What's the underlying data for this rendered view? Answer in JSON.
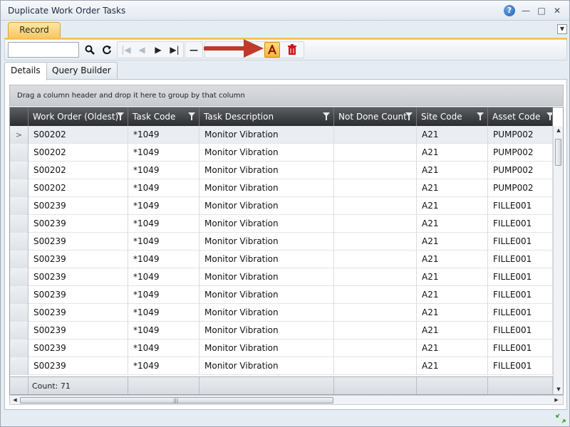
{
  "window": {
    "title": "Duplicate Work Order Tasks",
    "help_glyph": "?",
    "minimize_glyph": "—",
    "maximize_glyph": "□",
    "close_glyph": "✕"
  },
  "ribbon": {
    "tab_label": "Record",
    "dropdown_glyph": "▼"
  },
  "toolbar": {
    "search_value": "",
    "search_glyph": "🔍",
    "refresh_glyph": "↻",
    "first_glyph": "|◀",
    "prev_glyph": "◀",
    "next_glyph": "▶",
    "last_glyph": "▶|",
    "remove_glyph": "—",
    "highlight_glyph": "A",
    "delete_glyph": "🗑"
  },
  "tabs": [
    {
      "label": "Details",
      "active": true
    },
    {
      "label": "Query Builder",
      "active": false
    }
  ],
  "group_bar_text": "Drag a column header and drop it here to group by that column",
  "columns": [
    "Work Order (Oldest)",
    "Task Code",
    "Task Description",
    "Not Done Count",
    "Site Code",
    "Asset Code"
  ],
  "rows": [
    {
      "work_order": "S00202",
      "task_code": "*1049",
      "description": "Monitor Vibration",
      "not_done": "",
      "site": "A21",
      "asset": "PUMP002",
      "indicator": ">"
    },
    {
      "work_order": "S00202",
      "task_code": "*1049",
      "description": "Monitor Vibration",
      "not_done": "",
      "site": "A21",
      "asset": "PUMP002",
      "indicator": ""
    },
    {
      "work_order": "S00202",
      "task_code": "*1049",
      "description": "Monitor Vibration",
      "not_done": "",
      "site": "A21",
      "asset": "PUMP002",
      "indicator": ""
    },
    {
      "work_order": "S00202",
      "task_code": "*1049",
      "description": "Monitor Vibration",
      "not_done": "",
      "site": "A21",
      "asset": "PUMP002",
      "indicator": ""
    },
    {
      "work_order": "S00239",
      "task_code": "*1049",
      "description": "Monitor Vibration",
      "not_done": "",
      "site": "A21",
      "asset": "FILLE001",
      "indicator": ""
    },
    {
      "work_order": "S00239",
      "task_code": "*1049",
      "description": "Monitor Vibration",
      "not_done": "",
      "site": "A21",
      "asset": "FILLE001",
      "indicator": ""
    },
    {
      "work_order": "S00239",
      "task_code": "*1049",
      "description": "Monitor Vibration",
      "not_done": "",
      "site": "A21",
      "asset": "FILLE001",
      "indicator": ""
    },
    {
      "work_order": "S00239",
      "task_code": "*1049",
      "description": "Monitor Vibration",
      "not_done": "",
      "site": "A21",
      "asset": "FILLE001",
      "indicator": ""
    },
    {
      "work_order": "S00239",
      "task_code": "*1049",
      "description": "Monitor Vibration",
      "not_done": "",
      "site": "A21",
      "asset": "FILLE001",
      "indicator": ""
    },
    {
      "work_order": "S00239",
      "task_code": "*1049",
      "description": "Monitor Vibration",
      "not_done": "",
      "site": "A21",
      "asset": "FILLE001",
      "indicator": ""
    },
    {
      "work_order": "S00239",
      "task_code": "*1049",
      "description": "Monitor Vibration",
      "not_done": "",
      "site": "A21",
      "asset": "FILLE001",
      "indicator": ""
    },
    {
      "work_order": "S00239",
      "task_code": "*1049",
      "description": "Monitor Vibration",
      "not_done": "",
      "site": "A21",
      "asset": "FILLE001",
      "indicator": ""
    },
    {
      "work_order": "S00239",
      "task_code": "*1049",
      "description": "Monitor Vibration",
      "not_done": "",
      "site": "A21",
      "asset": "FILLE001",
      "indicator": ""
    },
    {
      "work_order": "S00239",
      "task_code": "*1049",
      "description": "Monitor Vibration",
      "not_done": "",
      "site": "A21",
      "asset": "FILLE001",
      "indicator": ""
    }
  ],
  "footer": {
    "count_label": "Count: 71"
  },
  "colors": {
    "accent": "#f8c95e",
    "annotation_arrow": "#c0392b",
    "delete_red": "#d0141a"
  }
}
